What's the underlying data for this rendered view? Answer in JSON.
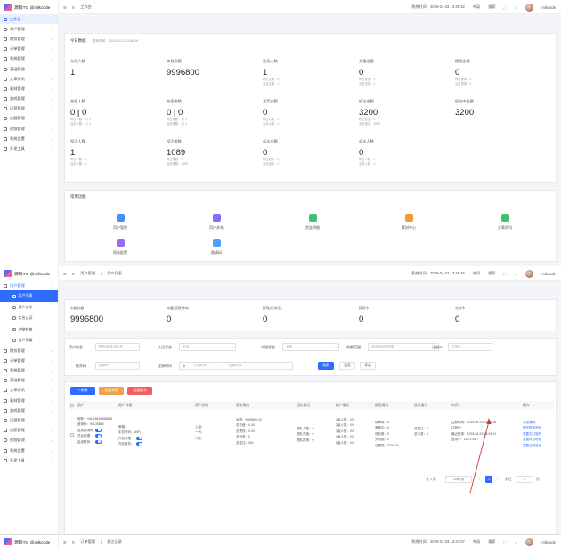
{
  "app": {
    "brand": "源码TG @mlkcode",
    "user": "mlkcode",
    "breadcrumb_home": "工作台",
    "time1": "系统时间：2025-04-23 13:46:32",
    "time2": "系统时间：2025-04-23 13:46:46",
    "time3": "系统时间：2025-04-23 13:47:07",
    "tool_a": "布局",
    "tool_b": "搜索",
    "tool_c": "全屏"
  },
  "sidebar": {
    "items": [
      {
        "label": "工作台"
      },
      {
        "label": "用户管理"
      },
      {
        "label": "财务管理"
      },
      {
        "label": "订单管理"
      },
      {
        "label": "系统管理"
      },
      {
        "label": "基础管理"
      },
      {
        "label": "文章资讯"
      },
      {
        "label": "素材管理"
      },
      {
        "label": "游戏管理"
      },
      {
        "label": "运营管理"
      },
      {
        "label": "佳肥管理"
      },
      {
        "label": "视频管理"
      },
      {
        "label": "系统设置"
      },
      {
        "label": "开发工具"
      }
    ],
    "sub": [
      {
        "label": "用户列表"
      },
      {
        "label": "用户关系"
      },
      {
        "label": "实名认证"
      },
      {
        "label": "冲突检查"
      },
      {
        "label": "用户等级"
      }
    ]
  },
  "dashboard": {
    "title": "今日数据",
    "update": "更新时间：2025-04-23 13:46:26",
    "stats": [
      {
        "label": "在线人数",
        "value": "1",
        "sub": []
      },
      {
        "label": "本月余额",
        "value": "9996800",
        "sub": []
      },
      {
        "label": "注册人数",
        "value": "1",
        "sub": [
          "昨日注册：0",
          "当月注册：1"
        ]
      },
      {
        "label": "充值金额",
        "value": "0",
        "sub": [
          "昨日充值：0",
          "当月充值：0"
        ]
      },
      {
        "label": "提现金额",
        "value": "0",
        "sub": [
          "昨日提现：0",
          "当月提现：0"
        ]
      },
      {
        "label": "充值人数",
        "value": "0 | 0",
        "sub": [
          "昨日人数：0 | 0",
          "当月人数：0 | 0"
        ]
      },
      {
        "label": "充值笔数",
        "value": "0 | 0",
        "sub": [
          "昨日笔数：0 | 0",
          "当月笔数：0 | 0"
        ]
      },
      {
        "label": "派奖金额",
        "value": "0",
        "sub": [
          "昨日派奖：0",
          "当月派奖：0"
        ]
      },
      {
        "label": "投注金额",
        "value": "3200",
        "sub": [
          "昨日投注：0",
          "当月投注：3200"
        ]
      },
      {
        "label": "投注中金额",
        "value": "3200",
        "sub": []
      },
      {
        "label": "投注人数",
        "value": "1",
        "sub": [
          "昨日人数：0",
          "当月人数：1"
        ]
      },
      {
        "label": "投注笔数",
        "value": "1089",
        "sub": [
          "昨日笔数：0",
          "当月笔数：1089"
        ]
      },
      {
        "label": "返水金额",
        "value": "0",
        "sub": [
          "昨日返水：0",
          "当月返水：0"
        ]
      },
      {
        "label": "返水人数",
        "value": "0",
        "sub": [
          "昨日人数：0",
          "当月人数：0"
        ]
      }
    ],
    "quick_title": "常用功能",
    "quick": [
      {
        "label": "用户管理",
        "color": "#4f8cf7"
      },
      {
        "label": "用户关系",
        "color": "#8b6cf6"
      },
      {
        "label": "资金明细",
        "color": "#3cc07a"
      },
      {
        "label": "素材中心",
        "color": "#f29a3a"
      },
      {
        "label": "文章资讯",
        "color": "#43c06a"
      },
      {
        "label": "网站配置",
        "color": "#9a6cf2"
      },
      {
        "label": "邀请码",
        "color": "#4fa3f7"
      }
    ]
  },
  "userlist": {
    "breadcrumb": [
      "用户管理",
      "用户列表"
    ],
    "stats": [
      {
        "label": "余额总额",
        "value": "9996800"
      },
      {
        "label": "充值(提现待审)",
        "value": "0"
      },
      {
        "label": "提现(已成功)",
        "value": "0"
      },
      {
        "label": "提现中",
        "value": "0"
      },
      {
        "label": "冻结中",
        "value": "0"
      }
    ],
    "filters": {
      "row1": [
        {
          "label": "用户信息",
          "placeholder": "账号/邮箱/手机号"
        },
        {
          "label": "认证状态",
          "placeholder": "全部"
        },
        {
          "label": "代理状态",
          "placeholder": "全部"
        },
        {
          "label": "余额范围",
          "placeholder": "请选择余额范围"
        },
        {
          "label": "注册IP",
          "placeholder": "注册IP"
        }
      ],
      "row2": [
        {
          "label": "推荐码",
          "placeholder": "推荐码"
        },
        {
          "label": "注册时间",
          "start": "开始时间",
          "end": "结束时间",
          "sep": "-"
        }
      ],
      "search": "搜索",
      "reset": "重置",
      "export": "导出"
    },
    "actions": [
      "+ 新增",
      "批量冻结",
      "批量解冻"
    ],
    "columns": [
      "用户",
      "用户详情",
      "用户授权",
      "资金情况",
      "团队情况",
      "推广情况",
      "提现情况",
      "投注情况",
      "时间",
      "操作"
    ],
    "row": {
      "user": [
        "昵称：+86 13636388888",
        "邀请码：96135585",
        "启用邀请码",
        "开启代理：",
        "启用财务："
      ],
      "detail": [
        "邮箱：",
        "手机号码：WiFi",
        "开启代理：",
        "开启财务："
      ],
      "auth": [
        "上级：",
        "一代：",
        "代数："
      ],
      "funds": [
        "余额：9996800.00",
        "总充值：0.00",
        "总提现：0.00",
        "总派奖：0",
        "总投注：361"
      ],
      "team": [
        "团队人数：0",
        "团队充值：0",
        "团队提现：0"
      ],
      "promo": [
        "1级人数：0/0",
        "2级人数：0/0",
        "3级人数：0/0",
        "4级人数：0/0",
        "5级人数：0/0"
      ],
      "withdraw": [
        "待审核：0",
        "审核中：5",
        "成功数：0",
        "失败额：0",
        "已提现：3200.00"
      ],
      "bet": [
        "总投注：0",
        "总中奖：0"
      ],
      "time": [
        "注册时间：2025-04-23 13:24:16",
        "注册IP：",
        "最近登录：2025-04-23 13:49:13",
        "登录IP：152.2.55.7"
      ],
      "ops": [
        "冻结/解冻",
        "修改登录密码",
        "重置支付密码",
        "重置财富地址",
        "重置谷歌验证"
      ]
    },
    "pager": {
      "total": "共 1 条",
      "size": "10条/页",
      "page": "1",
      "goto": "前往",
      "unit": "页"
    }
  },
  "order": {
    "breadcrumb": [
      "订单管理",
      "投注记录"
    ]
  }
}
